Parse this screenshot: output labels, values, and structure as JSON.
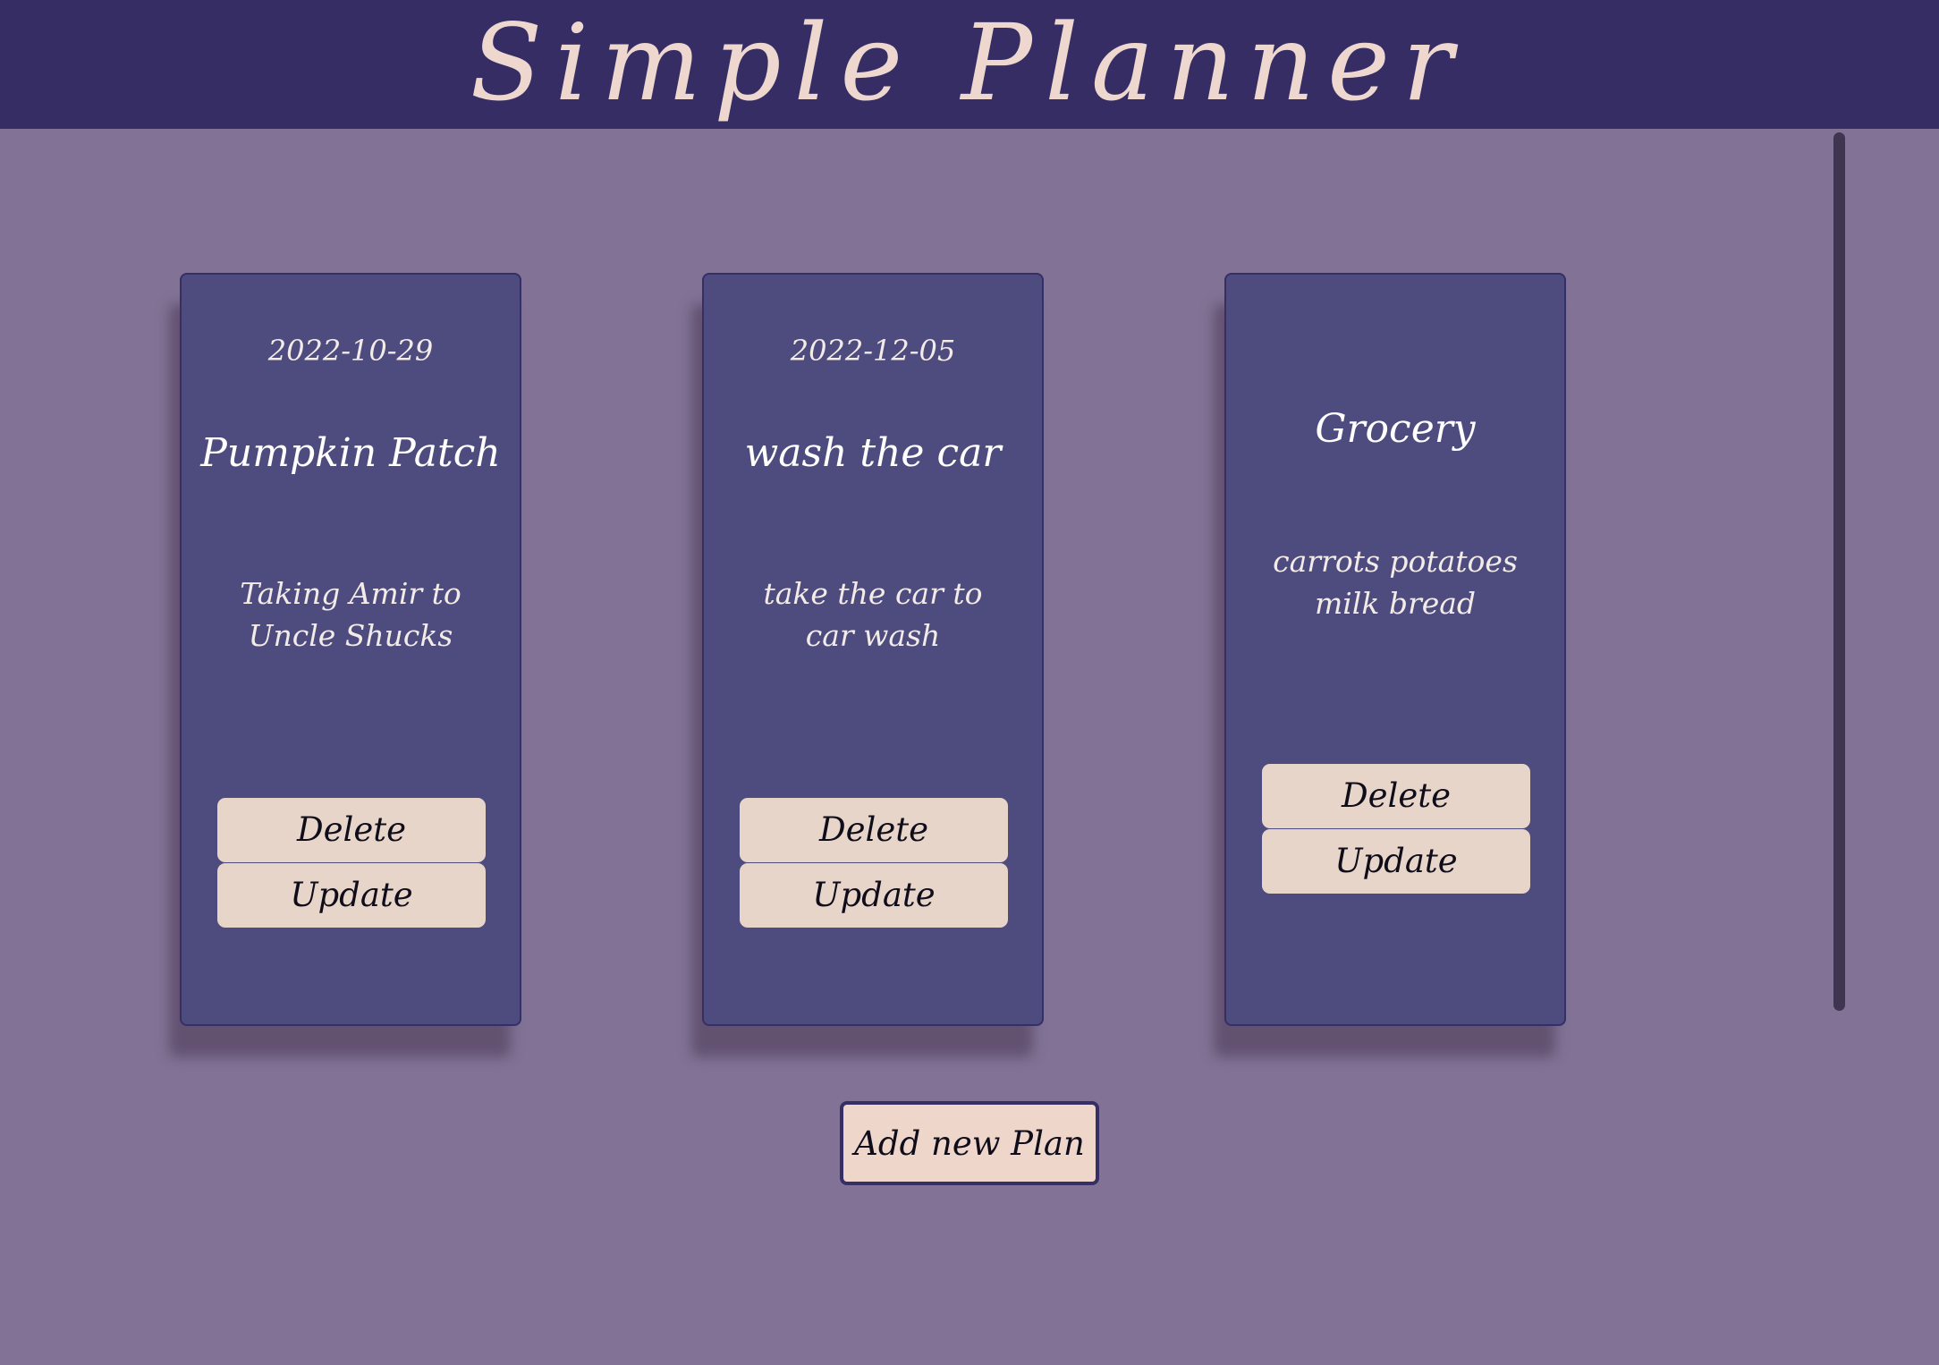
{
  "header": {
    "title": "Simple Planner"
  },
  "plans": [
    {
      "date": "2022-10-29",
      "title": "Pumpkin Patch",
      "description": "Taking Amir to Uncle Shucks",
      "delete_label": "Delete",
      "update_label": "Update"
    },
    {
      "date": "2022-12-05",
      "title": "wash the car",
      "description": "take the car to car wash",
      "delete_label": "Delete",
      "update_label": "Update"
    },
    {
      "date": "",
      "title": "Grocery",
      "description": "carrots potatoes milk bread",
      "delete_label": "Delete",
      "update_label": "Update"
    }
  ],
  "actions": {
    "add_label": "Add new Plan"
  },
  "colors": {
    "page_background": "#827396",
    "header_background": "#352d63",
    "card_background": "#4e4c7e",
    "button_background": "#e8d5ca",
    "title_text": "#eed7cf"
  }
}
